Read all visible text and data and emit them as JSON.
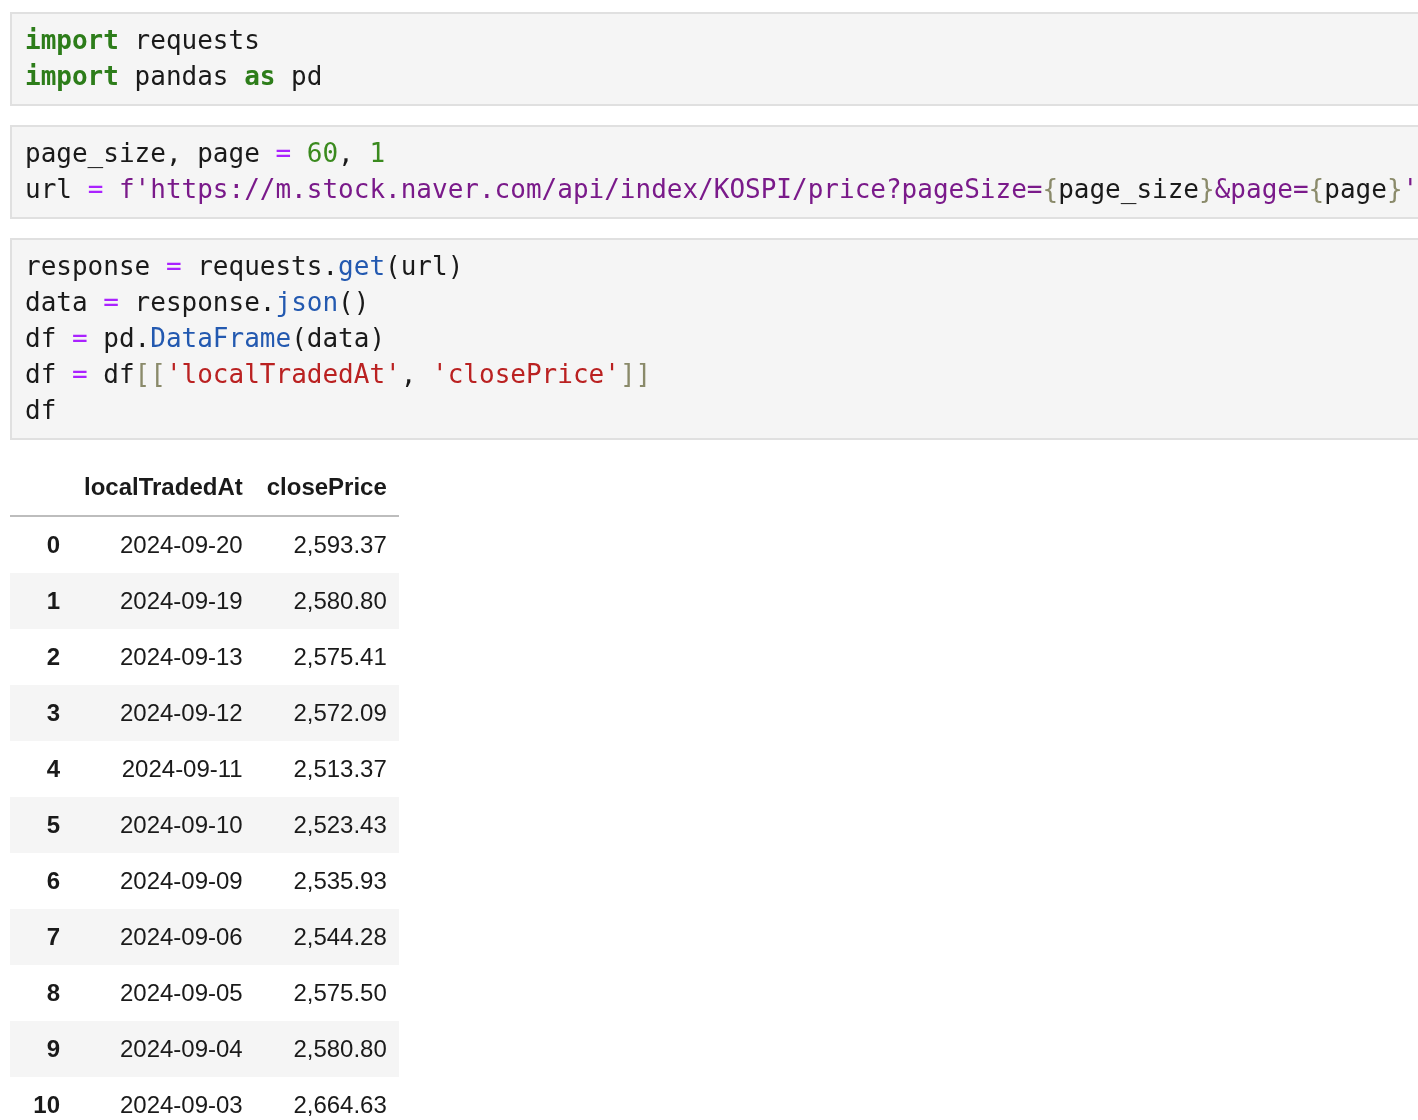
{
  "cells": [
    {
      "lines": [
        [
          {
            "text": "import",
            "kind": "keyword"
          },
          {
            "text": " requests",
            "kind": "plain"
          }
        ],
        [
          {
            "text": "import",
            "kind": "keyword"
          },
          {
            "text": " pandas ",
            "kind": "plain"
          },
          {
            "text": "as",
            "kind": "keyword"
          },
          {
            "text": " pd",
            "kind": "plain"
          }
        ]
      ]
    },
    {
      "lines": [
        [
          {
            "text": "page_size, page ",
            "kind": "plain"
          },
          {
            "text": "= ",
            "kind": "operator"
          },
          {
            "text": "60",
            "kind": "number"
          },
          {
            "text": ", ",
            "kind": "plain"
          },
          {
            "text": "1",
            "kind": "number"
          }
        ],
        [
          {
            "text": "url ",
            "kind": "plain"
          },
          {
            "text": "=",
            "kind": "operator"
          },
          {
            "text": " f'https://m.stock.naver.com/api/index/KOSPI/price?pageSize=",
            "kind": "fstring"
          },
          {
            "text": "{",
            "kind": "bracket"
          },
          {
            "text": "page_size",
            "kind": "plain"
          },
          {
            "text": "}",
            "kind": "bracket"
          },
          {
            "text": "&page=",
            "kind": "fstring"
          },
          {
            "text": "{",
            "kind": "bracket"
          },
          {
            "text": "page",
            "kind": "plain"
          },
          {
            "text": "}",
            "kind": "bracket"
          },
          {
            "text": "'",
            "kind": "fstring"
          }
        ]
      ]
    },
    {
      "lines": [
        [
          {
            "text": "response ",
            "kind": "plain"
          },
          {
            "text": "=",
            "kind": "operator"
          },
          {
            "text": " requests.",
            "kind": "plain"
          },
          {
            "text": "get",
            "kind": "func"
          },
          {
            "text": "(url)",
            "kind": "plain"
          }
        ],
        [
          {
            "text": "data ",
            "kind": "plain"
          },
          {
            "text": "=",
            "kind": "operator"
          },
          {
            "text": " response.",
            "kind": "plain"
          },
          {
            "text": "json",
            "kind": "func"
          },
          {
            "text": "()",
            "kind": "plain"
          }
        ],
        [
          {
            "text": "df ",
            "kind": "plain"
          },
          {
            "text": "=",
            "kind": "operator"
          },
          {
            "text": " pd.",
            "kind": "plain"
          },
          {
            "text": "DataFrame",
            "kind": "func"
          },
          {
            "text": "(data)",
            "kind": "plain"
          }
        ],
        [
          {
            "text": "df ",
            "kind": "plain"
          },
          {
            "text": "=",
            "kind": "operator"
          },
          {
            "text": " df",
            "kind": "plain"
          },
          {
            "text": "[[",
            "kind": "bracket"
          },
          {
            "text": "'localTradedAt'",
            "kind": "string"
          },
          {
            "text": ", ",
            "kind": "plain"
          },
          {
            "text": "'closePrice'",
            "kind": "string"
          },
          {
            "text": "]]",
            "kind": "bracket"
          }
        ],
        [
          {
            "text": "df",
            "kind": "plain"
          }
        ]
      ]
    }
  ],
  "table": {
    "columns": [
      "localTradedAt",
      "closePrice"
    ],
    "rows": [
      {
        "index": "0",
        "cells": [
          "2024-09-20",
          "2,593.37"
        ]
      },
      {
        "index": "1",
        "cells": [
          "2024-09-19",
          "2,580.80"
        ]
      },
      {
        "index": "2",
        "cells": [
          "2024-09-13",
          "2,575.41"
        ]
      },
      {
        "index": "3",
        "cells": [
          "2024-09-12",
          "2,572.09"
        ]
      },
      {
        "index": "4",
        "cells": [
          "2024-09-11",
          "2,513.37"
        ]
      },
      {
        "index": "5",
        "cells": [
          "2024-09-10",
          "2,523.43"
        ]
      },
      {
        "index": "6",
        "cells": [
          "2024-09-09",
          "2,535.93"
        ]
      },
      {
        "index": "7",
        "cells": [
          "2024-09-06",
          "2,544.28"
        ]
      },
      {
        "index": "8",
        "cells": [
          "2024-09-05",
          "2,575.50"
        ]
      },
      {
        "index": "9",
        "cells": [
          "2024-09-04",
          "2,580.80"
        ]
      },
      {
        "index": "10",
        "cells": [
          "2024-09-03",
          "2,664.63"
        ]
      }
    ]
  }
}
